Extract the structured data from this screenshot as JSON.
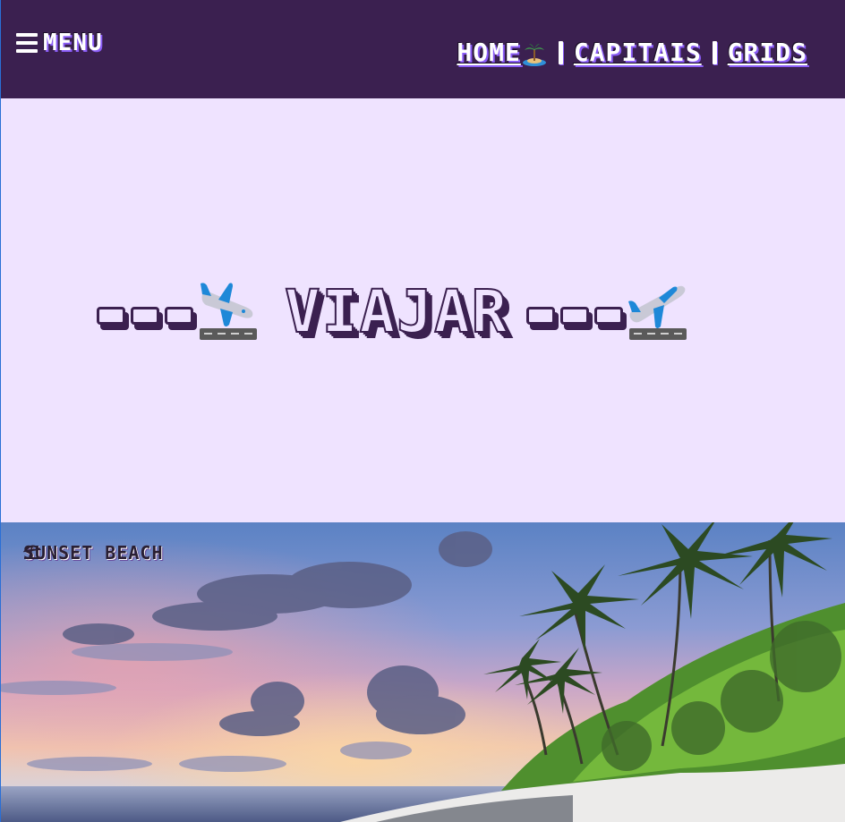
{
  "header": {
    "menu_label": "Menu",
    "nav": [
      {
        "label": "Home"
      },
      {
        "label": "Capitais"
      },
      {
        "label": "Grids"
      }
    ]
  },
  "hero": {
    "title": "VIAJAR",
    "icons": [
      "airplane-arrival-icon",
      "airplane-departure-icon"
    ]
  },
  "photo": {
    "caption": "Sunset Beach",
    "caption_icon": "beach-umbrella-icon"
  },
  "colors": {
    "header_bg": "#3b2050",
    "hero_bg": "#efe3ff",
    "accent": "#8a5cf6"
  }
}
